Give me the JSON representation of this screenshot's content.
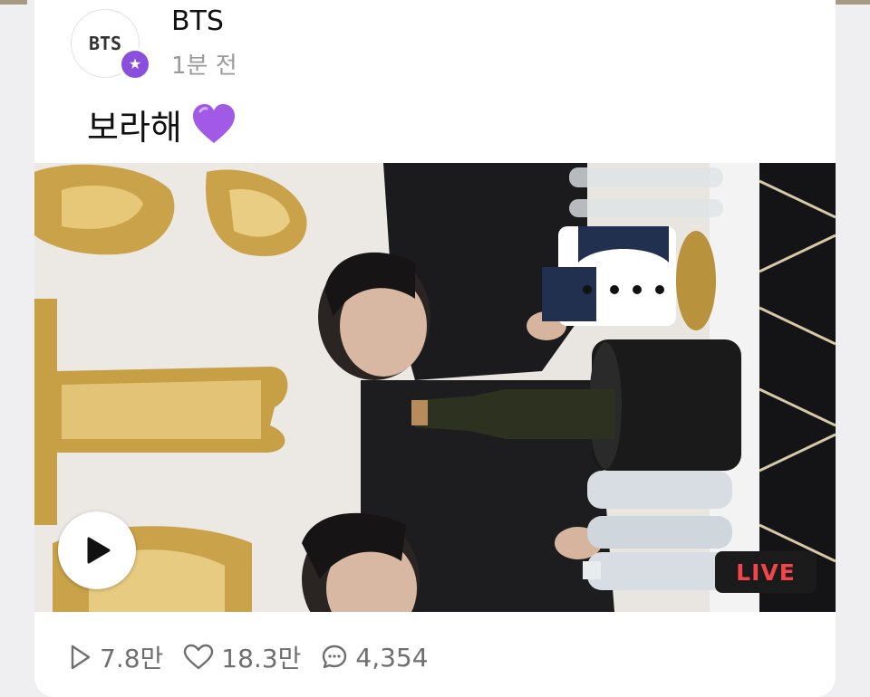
{
  "post": {
    "author": "BTS",
    "avatar_text": "BTS",
    "badge_icon": "star-icon",
    "time": "1분 전",
    "caption": "보라해",
    "caption_emoji": "purple-heart-icon"
  },
  "media": {
    "live_label": "LIVE",
    "play_icon": "play-icon"
  },
  "stats": {
    "views": "7.8만",
    "likes": "18.3만",
    "comments": "4,354"
  },
  "colors": {
    "badge": "#8a4fdc",
    "live_text": "#f2444b",
    "live_bg": "#1b1b1b",
    "heart": "#a259e6"
  }
}
